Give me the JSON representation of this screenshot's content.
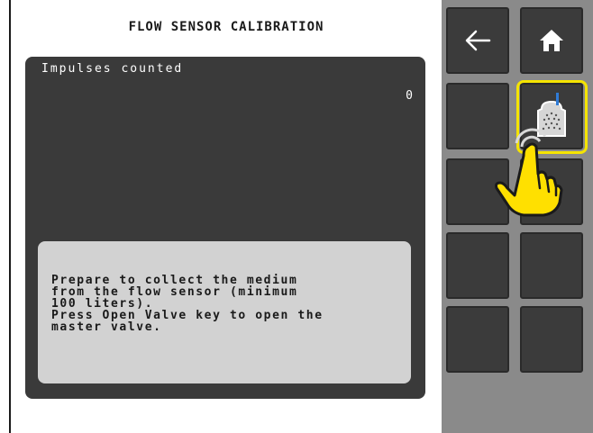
{
  "screen": {
    "title": "FLOW SENSOR CALIBRATION"
  },
  "panel": {
    "impulses_label": "Impulses counted",
    "impulses_value": "0",
    "message": "Prepare to collect the medium\nfrom the flow sensor (minimum\n100 liters).\nPress Open Valve key to open the\nmaster valve."
  },
  "sidebar": {
    "buttons": [
      {
        "icon": "back-arrow-icon"
      },
      {
        "icon": "home-icon"
      },
      {
        "icon": "blank"
      },
      {
        "icon": "open-valve-icon",
        "highlighted": true
      },
      {
        "icon": "blank"
      },
      {
        "icon": "blank"
      },
      {
        "icon": "blank"
      },
      {
        "icon": "blank"
      },
      {
        "icon": "blank"
      },
      {
        "icon": "blank"
      }
    ]
  },
  "colors": {
    "panel_bg": "#3a3a3a",
    "message_bg": "#d2d2d2",
    "sidebar_bg": "#8a8a8a",
    "highlight": "#f5e400",
    "hand": "#ffe000"
  }
}
